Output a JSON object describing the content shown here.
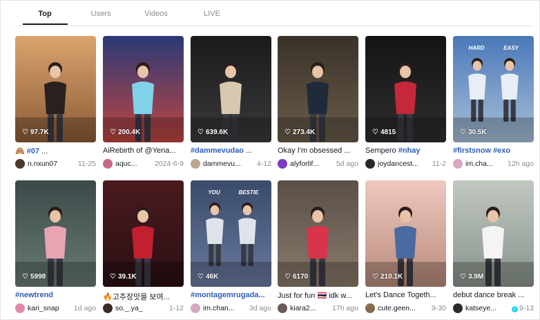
{
  "tabs": [
    "Top",
    "Users",
    "Videos",
    "LIVE"
  ],
  "videos": [
    {
      "likes": "97.7K",
      "caption_prefix": "🙈 ",
      "caption_tag": "#07",
      "caption_text": " ...",
      "user": "n.nxun07",
      "date": "11-25",
      "avatar_color": "#4a3a2c",
      "bg_top": "#d9a46e",
      "bg_bottom": "#8d5b36",
      "figure_color": "#2a2020"
    },
    {
      "likes": "200.4K",
      "caption_prefix": "",
      "caption_tag": "",
      "caption_text": "AiRebirth of @Yena...",
      "user": "aquc...",
      "date": "2024-6-9",
      "avatar_color": "#c46a86",
      "bg_top": "#2a3a78",
      "bg_bottom": "#c0453f",
      "figure_color": "#7fd2e8"
    },
    {
      "likes": "639.6K",
      "caption_prefix": "",
      "caption_tag": "#dammevudao",
      "caption_text": " ...",
      "user": "dammevu...",
      "date": "4-12",
      "avatar_color": "#bca78f",
      "bg_top": "#1a1a1a",
      "bg_bottom": "#3a3a3a",
      "figure_color": "#d8c8b0"
    },
    {
      "likes": "273.4K",
      "caption_prefix": "",
      "caption_tag": "",
      "caption_text": "Okay I'm obsessed ...",
      "user": "alyforlif...",
      "date": "5d ago",
      "avatar_color": "#7d3ac2",
      "bg_top": "#3a3228",
      "bg_bottom": "#6a5c4a",
      "figure_color": "#1f2a3a"
    },
    {
      "likes": "4815",
      "caption_prefix": "",
      "caption_tag": "",
      "caption_text": "Sempero ",
      "caption_tag2": "#nhay",
      "user": "joydancest...",
      "date": "11-2",
      "avatar_color": "#2a2a2a",
      "bg_top": "#141414",
      "bg_bottom": "#2e2e2e",
      "figure_color": "#c4283a"
    },
    {
      "likes": "30.5K",
      "caption_prefix": "",
      "caption_tag": "#firstsnow #exo",
      "caption_text": "",
      "user": "im.cha...",
      "date": "12h ago",
      "avatar_color": "#d6a8c4",
      "bg_top": "#4a78b8",
      "bg_bottom": "#a8c0d8",
      "figure_color": "#e8eef6",
      "overlay_left": "HARD",
      "overlay_right": "EASY"
    },
    {
      "likes": "5998",
      "caption_prefix": "",
      "caption_tag": "#newtrend",
      "caption_text": "",
      "user": "kari_snap",
      "date": "1d ago",
      "avatar_color": "#e08aa8",
      "bg_top": "#3a4a48",
      "bg_bottom": "#6a7a74",
      "figure_color": "#e9a4b4"
    },
    {
      "likes": "39.1K",
      "caption_prefix": "🔥",
      "caption_tag": "",
      "caption_text": "고추장맛을 보여...",
      "user": "so._.ya_",
      "date": "1-12",
      "avatar_color": "#3a2a2a",
      "bg_top": "#4a1a1e",
      "bg_bottom": "#2a1014",
      "figure_color": "#c22030"
    },
    {
      "likes": "46K",
      "caption_prefix": "",
      "caption_tag": "#montagemrugada...",
      "caption_text": "",
      "user": "im.chan...",
      "date": "3d ago",
      "avatar_color": "#d6a8c4",
      "bg_top": "#3a4a6a",
      "bg_bottom": "#6a7aa0",
      "figure_color": "#e0e4ea",
      "overlay_left": "YOU",
      "overlay_right": "BESTIE"
    },
    {
      "likes": "6170",
      "caption_prefix": "",
      "caption_tag": "",
      "caption_text": "Just for fun 🇹🇭 idk w...",
      "user": "kiara2...",
      "date": "17h ago",
      "avatar_color": "#6a5a5a",
      "bg_top": "#5a5048",
      "bg_bottom": "#8a7a6a",
      "figure_color": "#d8344a"
    },
    {
      "likes": "210.1K",
      "caption_prefix": "",
      "caption_tag": "",
      "caption_text": "Let's Dance Togeth...",
      "user": "cute.geen...",
      "date": "9-30",
      "avatar_color": "#8a6a4a",
      "bg_top": "#f0c8c0",
      "bg_bottom": "#b88a7a",
      "figure_color": "#4a6aa0"
    },
    {
      "likes": "3.9M",
      "caption_prefix": "",
      "caption_tag": "",
      "caption_text": "debut dance break ...",
      "user": "katseye...",
      "date": "9-13",
      "avatar_color": "#2a2a2a",
      "bg_top": "#c0c8c0",
      "bg_bottom": "#8a948c",
      "figure_color": "#f4f4f4",
      "verified": true
    }
  ]
}
